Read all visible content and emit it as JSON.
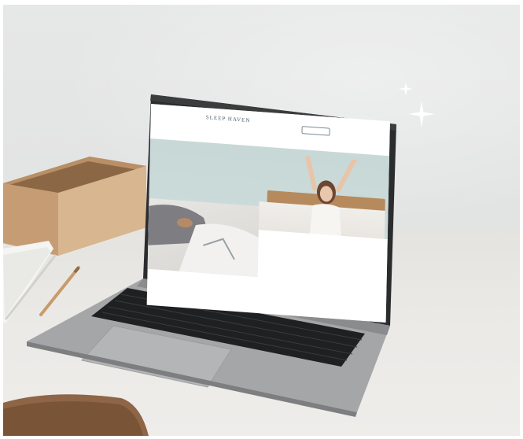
{
  "scene": {
    "description_tags": [
      "laptop",
      "desk",
      "wooden-tray",
      "notebook",
      "pencils",
      "chair",
      "sparkles"
    ]
  },
  "website": {
    "brand": "SLEEP HAVEN",
    "brand_tagline": "",
    "header_button": "",
    "nav_items": [],
    "hero_title": "",
    "hero_text": "",
    "bottom_text": ""
  }
}
